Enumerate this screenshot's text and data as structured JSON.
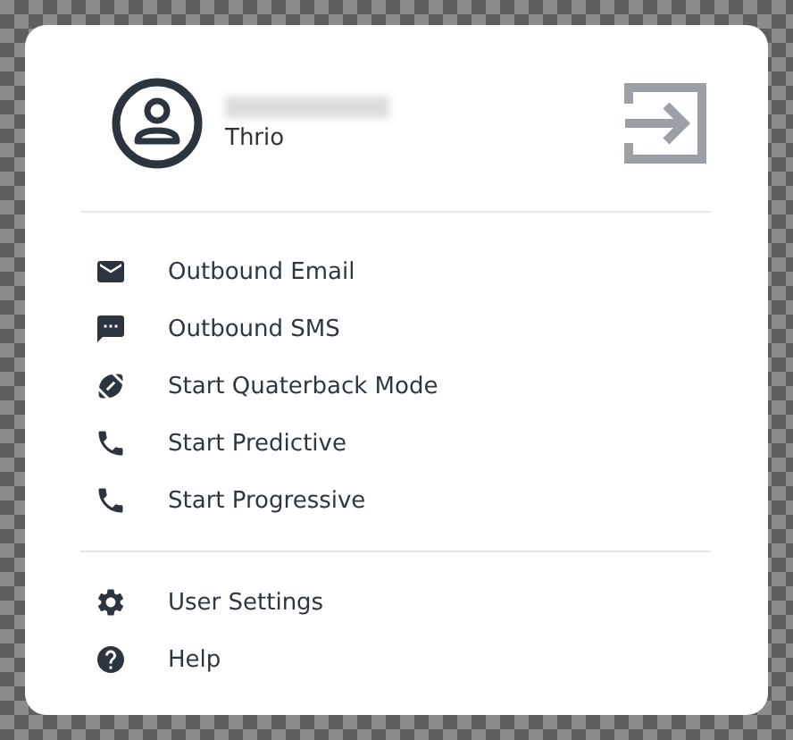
{
  "user": {
    "organization": "Thrio",
    "name_redacted": true
  },
  "menu_sections": [
    {
      "items": [
        {
          "kind": "email",
          "label": "Outbound Email"
        },
        {
          "kind": "sms",
          "label": "Outbound SMS"
        },
        {
          "kind": "football",
          "label": "Start Quaterback Mode"
        },
        {
          "kind": "phone",
          "label": "Start Predictive"
        },
        {
          "kind": "phone",
          "label": "Start Progressive"
        }
      ]
    },
    {
      "items": [
        {
          "kind": "settings",
          "label": "User Settings"
        },
        {
          "kind": "help",
          "label": "Help"
        }
      ]
    }
  ]
}
